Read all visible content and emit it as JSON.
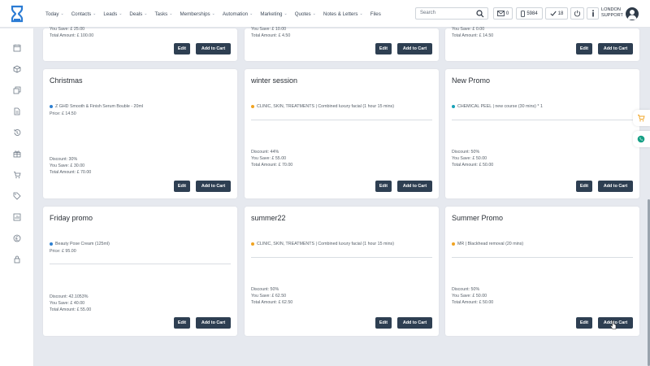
{
  "nav": {
    "items": [
      {
        "label": "Today",
        "chev": "⌄"
      },
      {
        "label": "Contacts",
        "chev": "⌄"
      },
      {
        "label": "Leads",
        "chev": "⌄"
      },
      {
        "label": "Deals",
        "chev": "⌄"
      },
      {
        "label": "Tasks",
        "chev": "⌄"
      },
      {
        "label": "Memberships",
        "chev": "⌄"
      },
      {
        "label": "Automation",
        "chev": "⌄"
      },
      {
        "label": "Marketing",
        "chev": "⌄"
      },
      {
        "label": "Quotes",
        "chev": "⌄"
      },
      {
        "label": "Notes & Letters",
        "chev": "⌄"
      },
      {
        "label": "Files",
        "chev": ""
      }
    ]
  },
  "search": {
    "placeholder": "Search"
  },
  "toolbar": {
    "messages_count": "0",
    "sms_count": "5984",
    "tasks_count": "18"
  },
  "user": {
    "line1": "LONDON",
    "line2": "SUPPORT"
  },
  "colors": {
    "accent": "#2e3f52",
    "dot_blue": "#2f80d1",
    "dot_orange": "#f0a321",
    "dot_teal": "#17a2b8"
  },
  "labels": {
    "edit": "Edit",
    "add_to_cart": "Add to Cart"
  },
  "top_row": [
    {
      "you_save": "You Save: £ 25.00",
      "total": "Total Amount: £ 100.00"
    },
    {
      "you_save": "You Save: £ 10.00",
      "total": "Total Amount: £ 4.50"
    },
    {
      "you_save": "You Save: £ 0.00",
      "total": "Total Amount: £ 14.50"
    }
  ],
  "cards": [
    {
      "title": "Christmas",
      "dot": "blue",
      "item": "Z GHD Smooth & Finish Serum Bouble - 20ml",
      "price": "Price: £ 14.50",
      "discount": "Discount: 30%",
      "you_save": "You Save: £ 30.00",
      "total": "Total Amount: £ 70.00"
    },
    {
      "title": "winter session",
      "dot": "orange",
      "item": "CLINIC, SKIN, TREATMENTS | Combined luxury facial (1 hour 15 mins)",
      "price": "",
      "discount": "Discount: 44%",
      "you_save": "You Save: £ 55.00",
      "total": "Total Amount: £ 70.00"
    },
    {
      "title": "New Promo",
      "dot": "teal",
      "item": "CHEMICAL PEEL | new course (30 mins) * 1",
      "price": "",
      "discount": "Discount: 50%",
      "you_save": "You Save: £ 50.00",
      "total": "Total Amount: £ 50.00"
    },
    {
      "title": "Friday promo",
      "dot": "blue",
      "item": "Beauty Pose Cream (125ml)",
      "price": "Price: £ 95.00",
      "discount": "Discount: 42.1053%",
      "you_save": "You Save: £ 40.00",
      "total": "Total Amount: £ 55.00"
    },
    {
      "title": "summer22",
      "dot": "orange",
      "item": "CLINIC, SKIN, TREATMENTS | Combined luxury facial (1 hour 15 mins)",
      "price": "",
      "discount": "Discount: 50%",
      "you_save": "You Save: £ 62.50",
      "total": "Total Amount: £ 62.50"
    },
    {
      "title": "Summer Promo",
      "dot": "orange",
      "item": "MR | Blackhead removal (20 mins)",
      "price": "",
      "discount": "Discount: 50%",
      "you_save": "You Save: £ 50.00",
      "total": "Total Amount: £ 50.00"
    }
  ]
}
